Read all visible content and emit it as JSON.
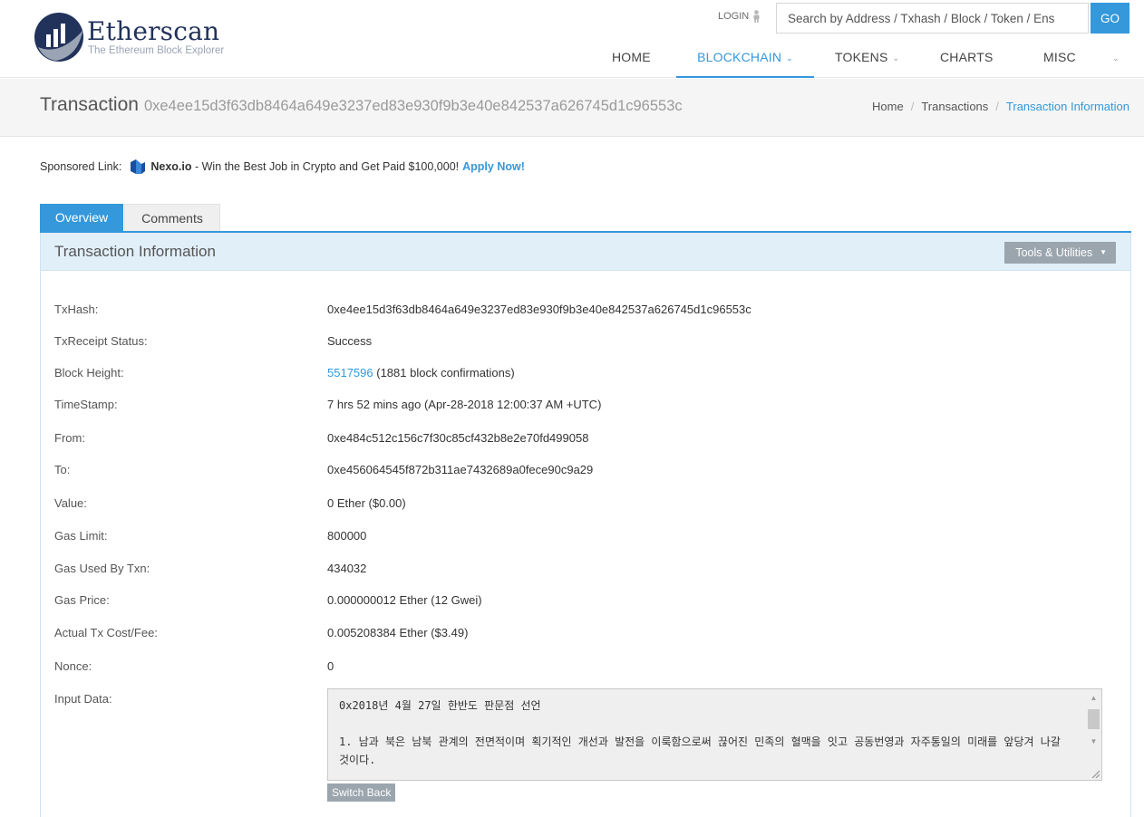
{
  "brand": {
    "name": "Etherscan",
    "tagline": "The Ethereum Block Explorer"
  },
  "header": {
    "login_label": "LOGIN",
    "search_placeholder": "Search by Address / Txhash / Block / Token / Ens",
    "go_label": "GO",
    "nav": [
      {
        "label": "HOME",
        "active": false
      },
      {
        "label": "BLOCKCHAIN",
        "active": true
      },
      {
        "label": "TOKENS",
        "active": false
      },
      {
        "label": "CHARTS",
        "active": false
      },
      {
        "label": "MISC",
        "active": false
      }
    ]
  },
  "title": {
    "label": "Transaction",
    "hash": "0xe4ee15d3f63db8464a649e3237ed83e930f9b3e40e842537a626745d1c96553c"
  },
  "breadcrumb": [
    "Home",
    "Transactions",
    "Transaction Information"
  ],
  "sponsor": {
    "prefix": "Sponsored Link:",
    "brand": "Nexo.io",
    "text": "- Win the Best Job in Crypto and Get Paid $100,000!",
    "cta": "Apply Now!"
  },
  "tabs": [
    "Overview",
    "Comments"
  ],
  "panel": {
    "title": "Transaction Information",
    "tools_label": "Tools & Utilities"
  },
  "details": {
    "txhash": {
      "label": "TxHash:",
      "value": "0xe4ee15d3f63db8464a649e3237ed83e930f9b3e40e842537a626745d1c96553c"
    },
    "status": {
      "label": "TxReceipt Status:",
      "value": "Success"
    },
    "block": {
      "label": "Block Height:",
      "number": "5517596",
      "confirmations": "(1881 block confirmations)"
    },
    "timestamp": {
      "label": "TimeStamp:",
      "value": "7 hrs 52 mins ago (Apr-28-2018 12:00:37 AM +UTC)"
    },
    "from": {
      "label": "From:",
      "value": "0xe484c512c156c7f30c85cf432b8e2e70fd499058"
    },
    "to": {
      "label": "To:",
      "value": "0xe456064545f872b311ae7432689a0fece90c9a29"
    },
    "value": {
      "label": "Value:",
      "value": "0 Ether ($0.00)"
    },
    "gas_limit": {
      "label": "Gas Limit:",
      "value": "800000"
    },
    "gas_used": {
      "label": "Gas Used By Txn:",
      "value": "434032"
    },
    "gas_price": {
      "label": "Gas Price:",
      "value": "0.000000012 Ether (12 Gwei)"
    },
    "tx_fee": {
      "label": "Actual Tx Cost/Fee:",
      "value": "0.005208384 Ether ($3.49)"
    },
    "nonce": {
      "label": "Nonce:",
      "value": "0"
    },
    "input": {
      "label": "Input Data:",
      "text": "0x2018년 4월 27일 한반도 판문점 선언\n\n1. 남과 북은 남북 관계의 전면적이며 획기적인 개선과 발전을 이룩함으로써 끊어진 민족의 혈맥을 잇고 공동번영과 자주통일의 미래를 앞당겨 나갈 것이다.",
      "switch_label": "Switch Back"
    }
  },
  "colors": {
    "accent": "#3498db",
    "success": "#2e8b2e",
    "panel_head": "#e1eff9",
    "brand_navy": "#21325b"
  }
}
